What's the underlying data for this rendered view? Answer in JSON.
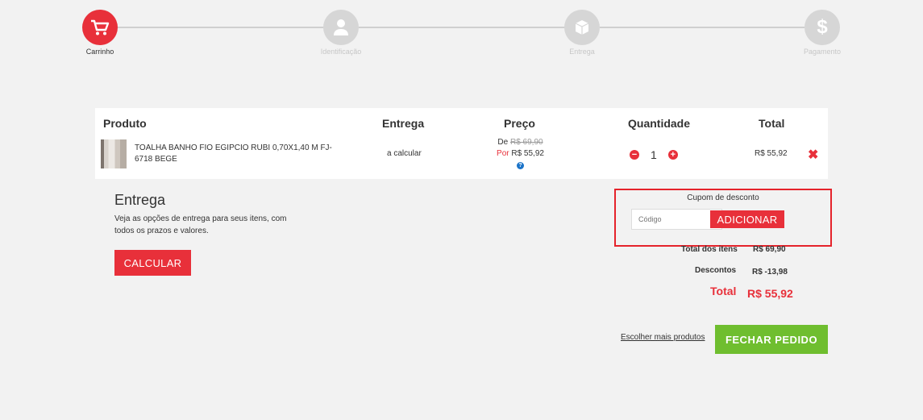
{
  "steps": [
    {
      "label": "Carrinho",
      "icon": "cart-icon",
      "active": true
    },
    {
      "label": "Identificação",
      "icon": "user-icon",
      "active": false
    },
    {
      "label": "Entrega",
      "icon": "box-icon",
      "active": false
    },
    {
      "label": "Pagamento",
      "icon": "dollar-icon",
      "active": false
    }
  ],
  "cart": {
    "headers": {
      "product": "Produto",
      "delivery": "Entrega",
      "price": "Preço",
      "quantity": "Quantidade",
      "total": "Total"
    },
    "item": {
      "name": "TOALHA BANHO FIO EGIPCIO RUBI 0,70X1,40 M FJ-6718 BEGE",
      "delivery": "a calcular",
      "price_from_label": "De",
      "price_old": "R$ 69,90",
      "price_por_label": "Por",
      "price_new": "R$ 55,92",
      "quantity": "1",
      "total": "R$ 55,92"
    }
  },
  "shipping": {
    "title": "Entrega",
    "description": "Veja as opções de entrega para seus itens, com todos os prazos e valores.",
    "button": "CALCULAR"
  },
  "coupon": {
    "title": "Cupom de desconto",
    "placeholder": "Código",
    "button": "ADICIONAR"
  },
  "totals": {
    "items_label": "Total dos itens",
    "items_value": "R$ 69,90",
    "discount_label": "Descontos",
    "discount_value": "R$ -13,98",
    "total_label": "Total",
    "total_value": "R$ 55,92"
  },
  "actions": {
    "more_products": "Escolher mais produtos",
    "checkout": "FECHAR PEDIDO"
  },
  "colors": {
    "accent": "#e8303a",
    "checkout": "#6fbe2f",
    "coupon_border": "#e5232b"
  }
}
